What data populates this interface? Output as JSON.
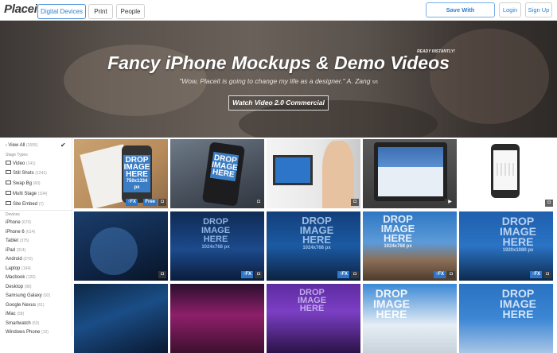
{
  "nav": {
    "logo": "Placeit",
    "tabs": [
      "Digital Devices",
      "Print",
      "People"
    ],
    "subscribe_label": "Save With Subscriptions!",
    "login_label": "Login",
    "signup_label": "Sign Up"
  },
  "hero": {
    "ready": "READY INSTANTLY!",
    "title": "Fancy iPhone Mockups & Demo Videos",
    "quote": "\"Wow, Placeit is going to change my life as a designer.\" A. Zang",
    "quote_rating": "5/5",
    "cta": "Watch Video 2.0 Commercial"
  },
  "sidebar": {
    "view_all": "View All",
    "view_all_count": "(1555)",
    "stage_types_heading": "Stage Types",
    "stage_types": [
      {
        "label": "Video",
        "count": "(141)"
      },
      {
        "label": "Still Shots",
        "count": "(1241)"
      },
      {
        "label": "Swap Bg",
        "count": "(60)"
      },
      {
        "label": "Multi Stage",
        "count": "(104)"
      },
      {
        "label": "Site Embed",
        "count": "(7)"
      }
    ],
    "devices_heading": "Devices",
    "devices": [
      {
        "label": "iPhone",
        "count": "(670)"
      },
      {
        "label": "iPhone 6",
        "count": "(614)"
      },
      {
        "label": "Tablet",
        "count": "(375)"
      },
      {
        "label": "iPad",
        "count": "(314)"
      },
      {
        "label": "Android",
        "count": "(270)"
      },
      {
        "label": "Laptop",
        "count": "(194)"
      },
      {
        "label": "Macbook",
        "count": "(120)"
      },
      {
        "label": "Desktop",
        "count": "(98)"
      },
      {
        "label": "Samsung Galaxy",
        "count": "(92)"
      },
      {
        "label": "Google Nexus",
        "count": "(61)"
      },
      {
        "label": "iMac",
        "count": "(58)"
      },
      {
        "label": "Smartwatch",
        "count": "(53)"
      },
      {
        "label": "Windows Phone",
        "count": "(12)"
      }
    ]
  },
  "grid": {
    "drop_line1": "DROP",
    "drop_line2": "IMAGE",
    "drop_line3": "HERE",
    "size_small": "750x1334 px",
    "size_large": "1024x768 px",
    "size_wide": "1920x1080 px",
    "fx": "FX",
    "free": "Free",
    "camera": "camera-icon"
  }
}
